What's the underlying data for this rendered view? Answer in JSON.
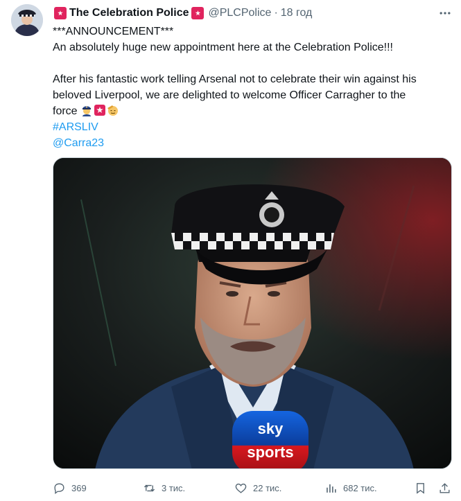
{
  "tweet": {
    "display_name": "The Celebration Police",
    "handle": "@PLCPolice",
    "separator": "·",
    "time": "18 год",
    "lines": {
      "l1": "***ANNOUNCEMENT***",
      "l2": "An absolutely huge new appointment here at the Celebration Police!!!",
      "l3": "After his fantastic work telling Arsenal not to celebrate their win against his",
      "l4": "beloved Liverpool, we are delighted to welcome Officer Carragher to the",
      "l5": "force"
    },
    "hashtag": "#ARSLIV",
    "mention": "@Carra23",
    "media_labels": {
      "line1": "sky",
      "line2": "sports"
    }
  },
  "actions": {
    "replies": "369",
    "reposts": "3 тис.",
    "likes": "22 тис.",
    "views": "682 тис."
  },
  "icons": {
    "avatar": "avatar-police-icon",
    "siren": "police-siren-icon",
    "more": "more-icon",
    "reply": "reply-icon",
    "repost": "repost-icon",
    "like": "heart-icon",
    "views": "views-icon",
    "bookmark": "bookmark-icon"
  },
  "colors": {
    "text": "#0f1419",
    "muted": "#536471",
    "link": "#1d9bf0",
    "siren": "#e0245e"
  }
}
